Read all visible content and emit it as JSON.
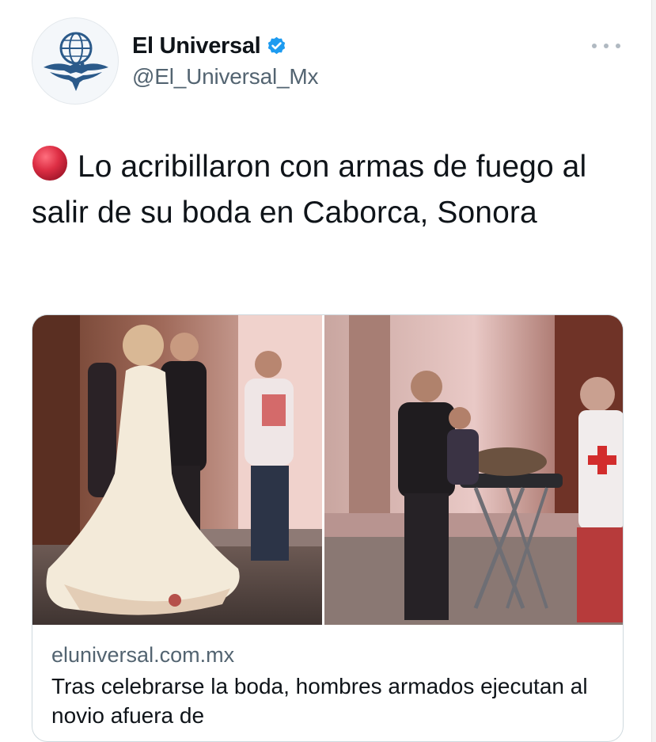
{
  "account": {
    "display_name": "El Universal",
    "handle": "@El_Universal_Mx",
    "verified": true,
    "avatar_icon": "eagle-globe-logo-icon"
  },
  "menu": {
    "more_icon": "more-dots-icon"
  },
  "tweet": {
    "emoji": "red-circle-icon",
    "text": "Lo acribillaron con armas de fuego al salir de su boda en Caborca, Sonora"
  },
  "link_card": {
    "domain": "eluniversal.com.mx",
    "title": "Tras celebrarse la boda, hombres armados ejecutan al novio afuera de"
  },
  "colors": {
    "text_primary": "#0f1419",
    "text_secondary": "#536471",
    "verified_blue": "#1d9bf0",
    "emoji_red": "#dd2e44",
    "card_border": "#cfd9de",
    "avatar_blue": "#2b5a8a"
  }
}
